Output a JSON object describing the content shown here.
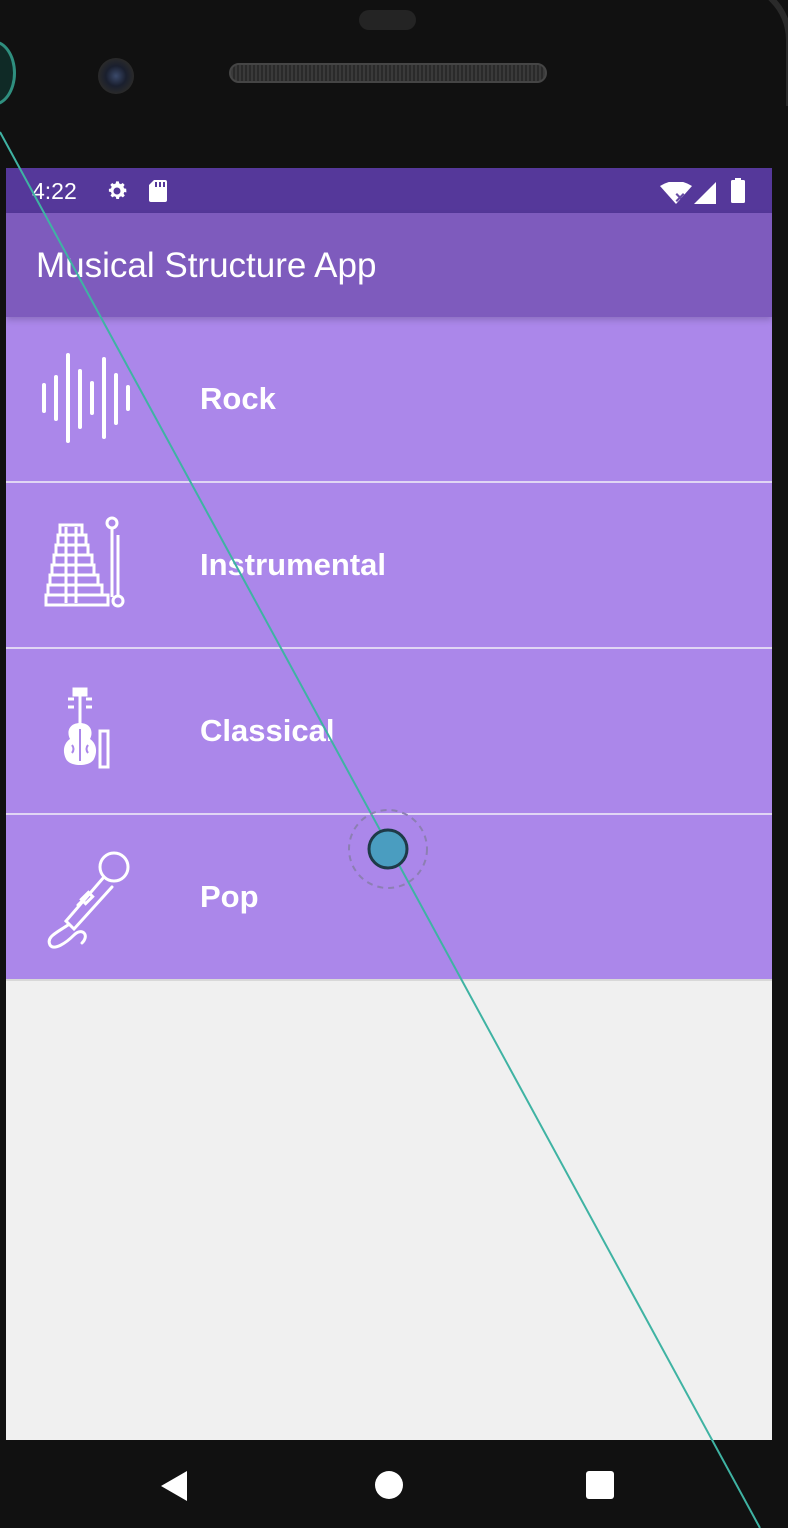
{
  "status_bar": {
    "time": "4:22",
    "icons_left": [
      "settings-icon",
      "sd-card-icon"
    ],
    "icons_right": [
      "wifi-icon",
      "signal-icon",
      "battery-icon"
    ]
  },
  "app_bar": {
    "title": "Musical Structure App"
  },
  "genres": [
    {
      "label": "Rock",
      "icon": "sound-wave-icon"
    },
    {
      "label": "Instrumental",
      "icon": "xylophone-icon"
    },
    {
      "label": "Classical",
      "icon": "violin-icon"
    },
    {
      "label": "Pop",
      "icon": "microphone-icon"
    }
  ],
  "nav_bar": {
    "buttons": [
      "back-icon",
      "home-icon",
      "recents-icon"
    ]
  },
  "colors": {
    "status_bar": "#55389a",
    "app_bar": "#7e5bbd",
    "list_item": "#ab87ea",
    "background": "#f0f0f0",
    "overlay_line": "#3fb3a3",
    "touch_marker": "#4a9dc0"
  }
}
